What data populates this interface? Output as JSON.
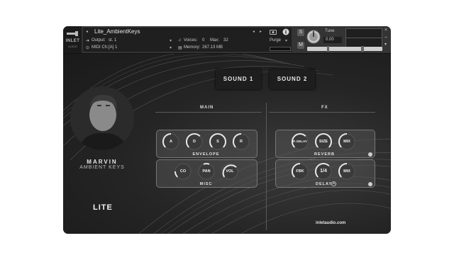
{
  "header": {
    "logo_text": "INLET",
    "logo_sub": "AUDIO",
    "instrument_title": "Lite_AmbientKeys",
    "output_label": "Output:",
    "output_value": "st. 1",
    "midi_label": "MIDI Ch:",
    "midi_value": "[A] 1",
    "voices_label": "Voices:",
    "voices_value": "0",
    "max_label": "Max:",
    "max_value": "32",
    "memory_label": "Memory:",
    "memory_value": "267.13 MB",
    "purge_label": "Purge",
    "tune_label": "Tune",
    "tune_value": "0.00",
    "s_button": "S",
    "m_button": "M"
  },
  "sounds": {
    "sound1": "SOUND 1",
    "sound2": "SOUND 2"
  },
  "sections": {
    "main": "MAIN",
    "fx": "FX"
  },
  "envelope": {
    "label": "ENVELOPE",
    "knobs": [
      "A",
      "D",
      "S",
      "R"
    ]
  },
  "misc": {
    "label": "MISC",
    "knobs": [
      "CO",
      "PAN",
      "VOL"
    ]
  },
  "reverb": {
    "label": "REVERB",
    "knobs": [
      "P. DELAY",
      "SIZE",
      "MIX"
    ]
  },
  "delay": {
    "label": "DELAY",
    "knobs": [
      "FBK",
      "1/4",
      "MIX"
    ]
  },
  "artist": {
    "name": "MARVIN",
    "subtitle": "AMBIENT KEYS"
  },
  "brand": {
    "lite": "LITE",
    "website": "inletaudio.com"
  }
}
